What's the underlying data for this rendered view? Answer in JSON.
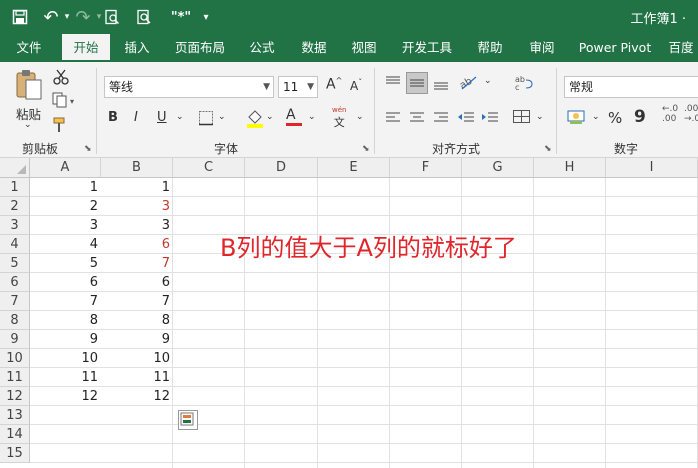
{
  "titlebar": {
    "doc_title": "工作簿1 ·"
  },
  "qat": {
    "save_icon": "save-icon",
    "undo_glyph": "↶",
    "redo_glyph": "↷",
    "print_preview_glyph": "⎙",
    "custom_glyph": "\"*\"",
    "more_glyph": "⌄"
  },
  "tabs": [
    "文件",
    "开始",
    "插入",
    "页面布局",
    "公式",
    "数据",
    "视图",
    "开发工具",
    "帮助",
    "审阅",
    "Power Pivot",
    "百度"
  ],
  "active_tab": "开始",
  "ribbon": {
    "clipboard": {
      "paste_label": "粘贴",
      "group_label": "剪贴板"
    },
    "font": {
      "font_name": "等线",
      "font_size": "11",
      "grow": "A",
      "shrink": "A",
      "bold": "B",
      "italic": "I",
      "underline": "U",
      "font_color_glyph": "A",
      "phonetic_top": "wén",
      "phonetic_bottom": "文",
      "group_label": "字体"
    },
    "alignment": {
      "group_label": "对齐方式"
    },
    "number": {
      "format": "常规",
      "percent": "%",
      "comma": "9",
      "group_label": "数字"
    }
  },
  "sheet": {
    "columns": [
      "A",
      "B",
      "C",
      "D",
      "E",
      "F",
      "G",
      "H",
      "I"
    ],
    "rows": [
      "1",
      "2",
      "3",
      "4",
      "5",
      "6",
      "7",
      "8",
      "9",
      "10",
      "11",
      "12",
      "13",
      "14",
      "15"
    ],
    "col_a": [
      "1",
      "2",
      "3",
      "4",
      "5",
      "6",
      "7",
      "8",
      "9",
      "10",
      "11",
      "12"
    ],
    "col_b": [
      "1",
      "3",
      "3",
      "6",
      "7",
      "6",
      "7",
      "8",
      "9",
      "10",
      "11",
      "12"
    ],
    "col_b_highlight": [
      false,
      true,
      false,
      true,
      true,
      false,
      false,
      false,
      false,
      false,
      false,
      false
    ],
    "highlight_color": "#c0392b",
    "note": "B列的值大于A列的就标好了"
  },
  "colors": {
    "brand": "#217346",
    "red_note": "#e0262b"
  }
}
